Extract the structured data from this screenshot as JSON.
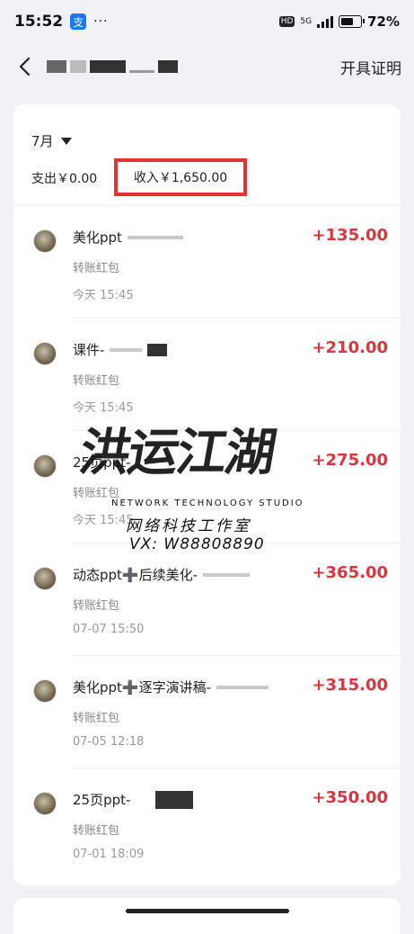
{
  "status_bar": {
    "time": "15:52",
    "alipay_badge": "支",
    "dots": "···",
    "hd": "HD",
    "network": "5G",
    "battery_pct": "72%",
    "battery_level": 0.72
  },
  "nav": {
    "action": "开具证明"
  },
  "summary": {
    "month": "7月",
    "expense": "支出￥0.00",
    "income": "收入￥1,650.00"
  },
  "transactions": [
    {
      "title": "美化ppt",
      "subtitle": "转账红包",
      "time": "今天 15:45",
      "amount": "+135.00"
    },
    {
      "title": "课件-",
      "subtitle": "转账红包",
      "time": "今天 15:45",
      "amount": "+210.00"
    },
    {
      "title": "25页ppt-",
      "subtitle": "转账红包",
      "time": "今天 15:45",
      "amount": "+275.00"
    },
    {
      "title": "动态ppt➕后续美化-",
      "subtitle": "转账红包",
      "time": "07-07 15:50",
      "amount": "+365.00"
    },
    {
      "title": "美化ppt➕逐字演讲稿-",
      "subtitle": "转账红包",
      "time": "07-05 12:18",
      "amount": "+315.00"
    },
    {
      "title": "25页ppt-",
      "subtitle": "转账红包",
      "time": "07-01 18:09",
      "amount": "+350.00"
    }
  ],
  "watermark": {
    "main": "洪运江湖",
    "line1": "NETWORK TECHNOLOGY STUDIO",
    "line2": "网络科技工作室",
    "line3": "VX: W88808890"
  },
  "colors": {
    "amount": "#d9363e",
    "highlight_box": "#e5322e",
    "background": "#f2f2f4"
  }
}
